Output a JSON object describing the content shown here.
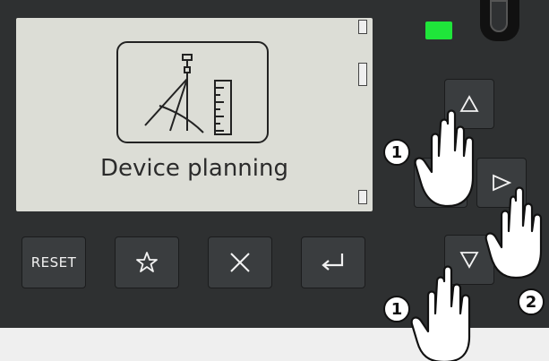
{
  "display": {
    "title": "Device planning",
    "icon": "device-planning-icon"
  },
  "status": {
    "led_color": "#1fe53a"
  },
  "buttons": {
    "reset_label": "RESET",
    "star_icon": "star-icon",
    "cancel_icon": "close-icon",
    "enter_icon": "enter-icon",
    "up_icon": "triangle-up-icon",
    "right_icon": "triangle-right-icon",
    "down_icon": "triangle-down-icon"
  },
  "annotations": {
    "step_up": "1",
    "step_right": "2",
    "step_down": "1"
  }
}
